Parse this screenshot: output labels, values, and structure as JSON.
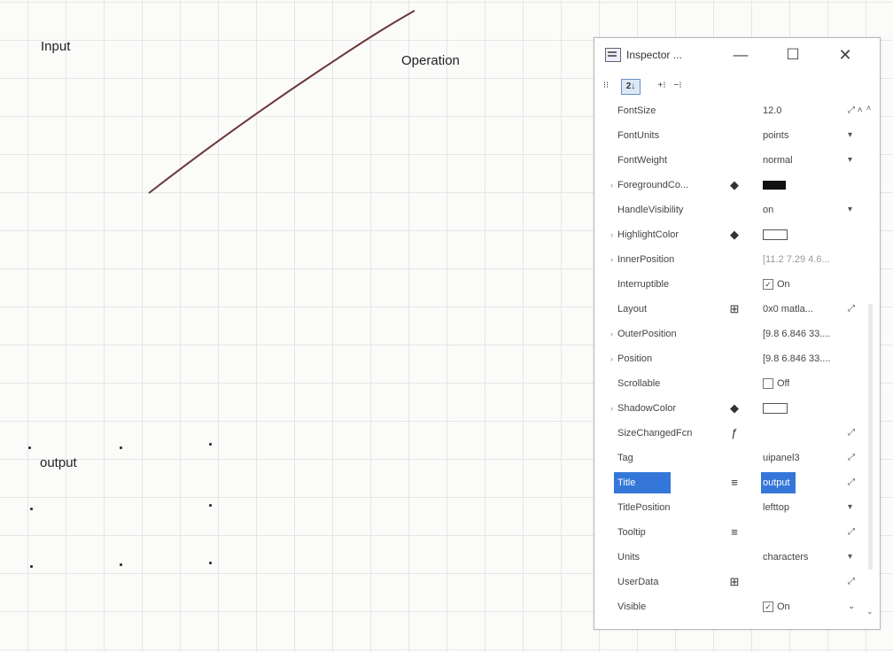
{
  "canvas": {
    "input_label": "Input",
    "operation_label": "Operation",
    "output_label": "output"
  },
  "inspector": {
    "title": "Inspector ...",
    "buttons": {
      "minimize": "—",
      "maximize": "☐",
      "close": "✕"
    },
    "toolbar": {
      "categorized": "⁝⁝",
      "sort": "2↓",
      "expand": "+⁝",
      "collapse": "−⁝"
    },
    "properties": [
      {
        "name": "FontSize",
        "value": "12.0",
        "control": "⤢ ˄"
      },
      {
        "name": "FontUnits",
        "value": "points",
        "control": "▾"
      },
      {
        "name": "FontWeight",
        "value": "normal",
        "control": "▾"
      },
      {
        "name": "ForegroundCo...",
        "expand": "›",
        "icon": "paint-bucket-icon",
        "swatch": "black"
      },
      {
        "name": "HandleVisibility",
        "value": "on",
        "control": "▾"
      },
      {
        "name": "HighlightColor",
        "expand": "›",
        "icon": "paint-bucket-icon",
        "swatch": "white"
      },
      {
        "name": "InnerPosition",
        "expand": "›",
        "value": "[11.2 7.29 4.6...",
        "dim": true
      },
      {
        "name": "Interruptible",
        "checkbox": "On"
      },
      {
        "name": "Layout",
        "icon": "grid-icon",
        "value": "0x0 matla...",
        "control": "⤢"
      },
      {
        "name": "OuterPosition",
        "expand": "›",
        "value": "[9.8 6.846 33...."
      },
      {
        "name": "Position",
        "expand": "›",
        "value": "[9.8 6.846 33...."
      },
      {
        "name": "Scrollable",
        "checkbox_off": "Off"
      },
      {
        "name": "ShadowColor",
        "expand": "›",
        "icon": "paint-bucket-icon",
        "swatch": "white"
      },
      {
        "name": "SizeChangedFcn",
        "icon": "function-icon",
        "control": "⤢"
      },
      {
        "name": "Tag",
        "value": "uipanel3",
        "control": "⤢"
      },
      {
        "name": "Title",
        "icon": "text-lines-icon",
        "value": "output",
        "control": "⤢",
        "selected": true
      },
      {
        "name": "TitlePosition",
        "value": "lefttop",
        "control": "▾"
      },
      {
        "name": "Tooltip",
        "icon": "text-lines-icon",
        "control": "⤢"
      },
      {
        "name": "Units",
        "value": "characters",
        "control": "▾"
      },
      {
        "name": "UserData",
        "icon": "grid-icon",
        "control": "⤢"
      },
      {
        "name": "Visible",
        "checkbox": "On",
        "control": "⌄"
      }
    ]
  },
  "colors": {
    "selection": "#3477d8",
    "grid": "#e6e6e6",
    "stroke": "#6b3838"
  }
}
